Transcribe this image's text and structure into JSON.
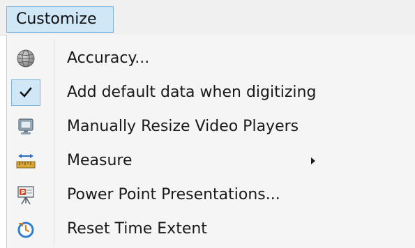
{
  "menu": {
    "title": "Customize",
    "items": [
      {
        "label": "Accuracy...",
        "icon": "globe-icon"
      },
      {
        "label": "Add default data when digitizing",
        "icon": "checkmark-icon",
        "checked": true
      },
      {
        "label": "Manually Resize Video Players",
        "icon": "monitor-icon"
      },
      {
        "label": "Measure",
        "icon": "ruler-icon",
        "has_submenu": true
      },
      {
        "label": "Power Point Presentations...",
        "icon": "presentation-icon"
      },
      {
        "label": "Reset Time Extent",
        "icon": "reset-clock-icon"
      }
    ]
  },
  "colors": {
    "highlight_fill": "#cfe7f7",
    "highlight_border": "#7fb4da",
    "menu_background": "#f5f5f5"
  }
}
